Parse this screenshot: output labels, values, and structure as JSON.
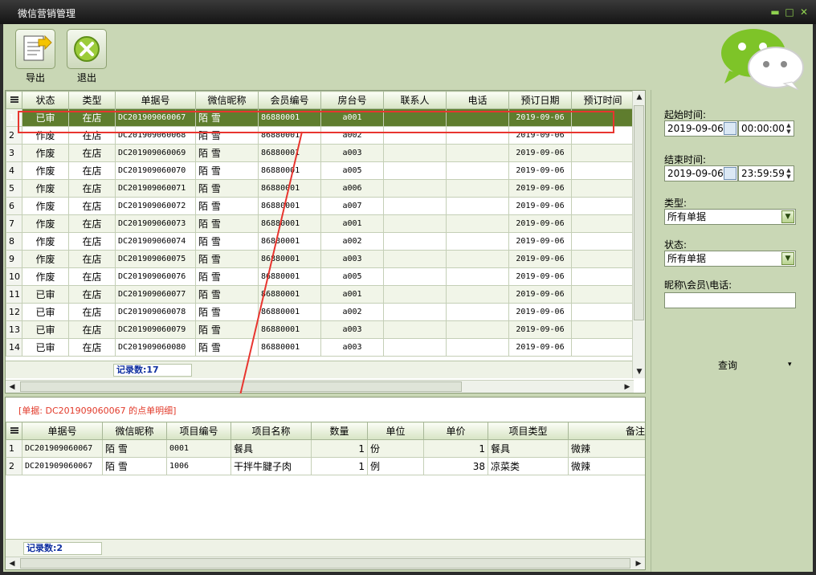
{
  "window": {
    "title": "微信营销管理",
    "controls": {
      "min": "▬",
      "max": "□",
      "close": "✕"
    }
  },
  "toolbar": {
    "export_label": "导出",
    "exit_label": "退出"
  },
  "grid1": {
    "columns": [
      "状态",
      "类型",
      "单据号",
      "微信昵称",
      "会员编号",
      "房台号",
      "联系人",
      "电话",
      "预订日期",
      "预订时间"
    ],
    "rows": [
      {
        "no": "1",
        "status": "已审",
        "type": "在店",
        "bill": "DC201909060067",
        "nick": "陌 雪",
        "member": "86880001",
        "room": "a001",
        "contact": "",
        "phone": "",
        "date": "2019-09-06",
        "time": ""
      },
      {
        "no": "2",
        "status": "作废",
        "type": "在店",
        "bill": "DC201909060068",
        "nick": "陌 雪",
        "member": "86880001",
        "room": "a002",
        "contact": "",
        "phone": "",
        "date": "2019-09-06",
        "time": ""
      },
      {
        "no": "3",
        "status": "作废",
        "type": "在店",
        "bill": "DC201909060069",
        "nick": "陌 雪",
        "member": "86880001",
        "room": "a003",
        "contact": "",
        "phone": "",
        "date": "2019-09-06",
        "time": ""
      },
      {
        "no": "4",
        "status": "作废",
        "type": "在店",
        "bill": "DC201909060070",
        "nick": "陌 雪",
        "member": "86880001",
        "room": "a005",
        "contact": "",
        "phone": "",
        "date": "2019-09-06",
        "time": ""
      },
      {
        "no": "5",
        "status": "作废",
        "type": "在店",
        "bill": "DC201909060071",
        "nick": "陌 雪",
        "member": "86880001",
        "room": "a006",
        "contact": "",
        "phone": "",
        "date": "2019-09-06",
        "time": ""
      },
      {
        "no": "6",
        "status": "作废",
        "type": "在店",
        "bill": "DC201909060072",
        "nick": "陌 雪",
        "member": "86880001",
        "room": "a007",
        "contact": "",
        "phone": "",
        "date": "2019-09-06",
        "time": ""
      },
      {
        "no": "7",
        "status": "作废",
        "type": "在店",
        "bill": "DC201909060073",
        "nick": "陌 雪",
        "member": "86880001",
        "room": "a001",
        "contact": "",
        "phone": "",
        "date": "2019-09-06",
        "time": ""
      },
      {
        "no": "8",
        "status": "作废",
        "type": "在店",
        "bill": "DC201909060074",
        "nick": "陌 雪",
        "member": "86880001",
        "room": "a002",
        "contact": "",
        "phone": "",
        "date": "2019-09-06",
        "time": ""
      },
      {
        "no": "9",
        "status": "作废",
        "type": "在店",
        "bill": "DC201909060075",
        "nick": "陌 雪",
        "member": "86880001",
        "room": "a003",
        "contact": "",
        "phone": "",
        "date": "2019-09-06",
        "time": ""
      },
      {
        "no": "10",
        "status": "作废",
        "type": "在店",
        "bill": "DC201909060076",
        "nick": "陌 雪",
        "member": "86880001",
        "room": "a005",
        "contact": "",
        "phone": "",
        "date": "2019-09-06",
        "time": ""
      },
      {
        "no": "11",
        "status": "已审",
        "type": "在店",
        "bill": "DC201909060077",
        "nick": "陌 雪",
        "member": "86880001",
        "room": "a001",
        "contact": "",
        "phone": "",
        "date": "2019-09-06",
        "time": ""
      },
      {
        "no": "12",
        "status": "已审",
        "type": "在店",
        "bill": "DC201909060078",
        "nick": "陌 雪",
        "member": "86880001",
        "room": "a002",
        "contact": "",
        "phone": "",
        "date": "2019-09-06",
        "time": ""
      },
      {
        "no": "13",
        "status": "已审",
        "type": "在店",
        "bill": "DC201909060079",
        "nick": "陌 雪",
        "member": "86880001",
        "room": "a003",
        "contact": "",
        "phone": "",
        "date": "2019-09-06",
        "time": ""
      },
      {
        "no": "14",
        "status": "已审",
        "type": "在店",
        "bill": "DC201909060080",
        "nick": "陌 雪",
        "member": "86880001",
        "room": "a003",
        "contact": "",
        "phone": "",
        "date": "2019-09-06",
        "time": ""
      }
    ],
    "record_count": "记录数:17"
  },
  "detail": {
    "title": "[单据: DC201909060067 的点单明细]",
    "columns": [
      "单据号",
      "微信昵称",
      "项目编号",
      "项目名称",
      "数量",
      "单位",
      "单价",
      "项目类型",
      "备注"
    ],
    "rows": [
      {
        "no": "1",
        "bill": "DC201909060067",
        "nick": "陌 雪",
        "code": "0001",
        "name": "餐具",
        "qty": "1",
        "unit": "份",
        "price": "1",
        "category": "餐具",
        "note": "微辣"
      },
      {
        "no": "2",
        "bill": "DC201909060067",
        "nick": "陌 雪",
        "code": "1006",
        "name": "干拌牛腱子肉",
        "qty": "1",
        "unit": "例",
        "price": "38",
        "category": "凉菜类",
        "note": "微辣"
      }
    ],
    "record_count": "记录数:2"
  },
  "side": {
    "start_label": "起始时间:",
    "start_date": "2019-09-06",
    "start_time": "00:00:00",
    "end_label": "结束时间:",
    "end_date": "2019-09-06",
    "end_time": "23:59:59",
    "type_label": "类型:",
    "type_value": "所有单据",
    "status_label": "状态:",
    "status_value": "所有单据",
    "search_label": "昵称\\会员\\电话:",
    "search_value": "",
    "query_label": "查询",
    "query_arrow": "▾"
  },
  "colors": {
    "accent": "#5f7d2e",
    "panel": "#c9d7b5",
    "highlight": "#e8352f",
    "count_text": "#1030a0"
  }
}
